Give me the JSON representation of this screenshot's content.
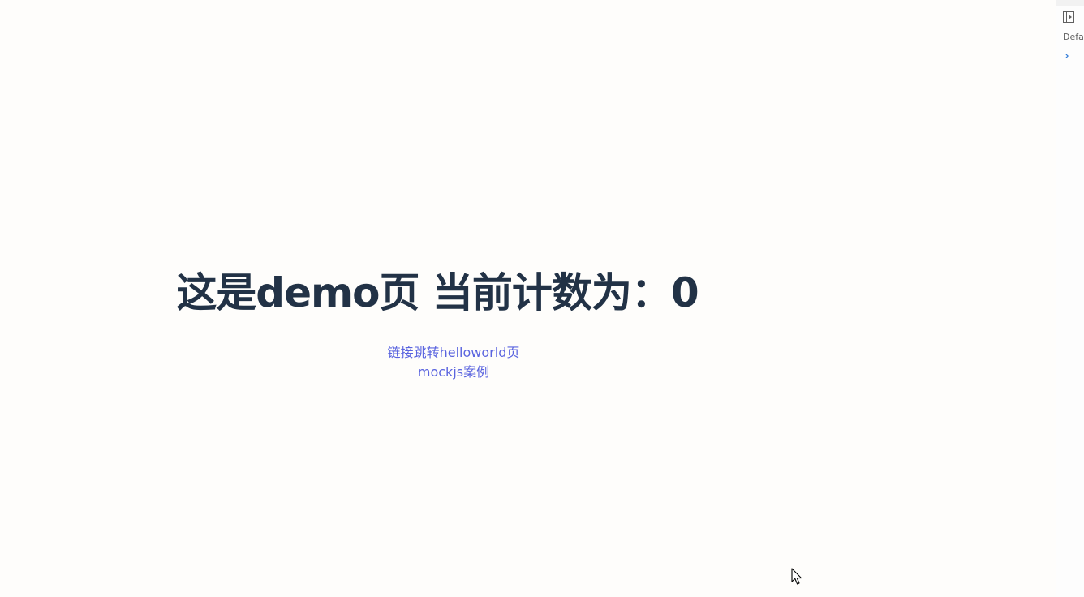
{
  "page": {
    "title": "这是demo页 当前计数为：0",
    "links": [
      {
        "label": "链接跳转helloworld页"
      },
      {
        "label": "mockjs案例"
      }
    ]
  },
  "devtools": {
    "context_label": "Defau",
    "prompt_symbol": "›",
    "icons": [
      "sidebar-toggle-icon",
      "console-prompt-icon"
    ]
  },
  "colors": {
    "background": "#fefdfb",
    "title": "#223246",
    "link": "#5a64df",
    "devtools_prompt": "#2f7ad8"
  }
}
